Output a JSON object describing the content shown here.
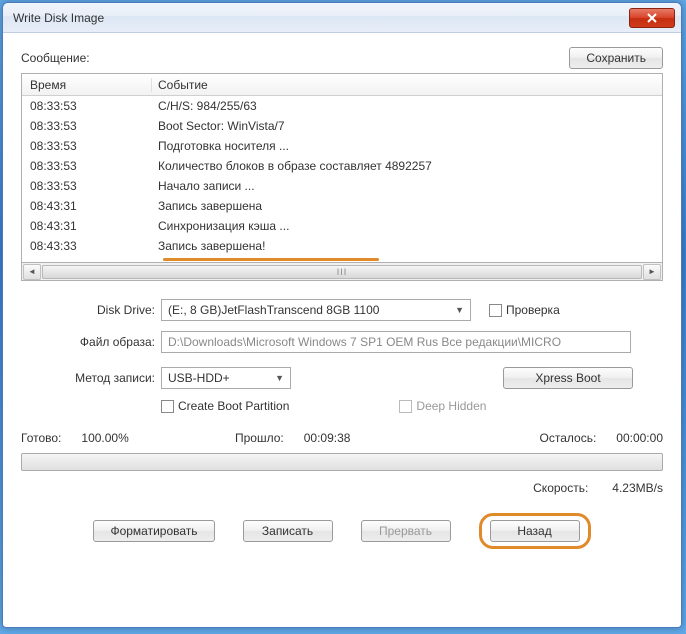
{
  "window": {
    "title": "Write Disk Image"
  },
  "msg": {
    "label": "Сообщение:",
    "save_btn": "Сохранить"
  },
  "log": {
    "col_time": "Время",
    "col_event": "Событие",
    "rows": [
      {
        "time": "08:33:53",
        "event": "C/H/S: 984/255/63"
      },
      {
        "time": "08:33:53",
        "event": "Boot Sector: WinVista/7"
      },
      {
        "time": "08:33:53",
        "event": "Подготовка носителя ..."
      },
      {
        "time": "08:33:53",
        "event": "Количество блоков в образе составляет 4892257"
      },
      {
        "time": "08:33:53",
        "event": "Начало записи ..."
      },
      {
        "time": "08:43:31",
        "event": "Запись завершена"
      },
      {
        "time": "08:43:31",
        "event": "Синхронизация кэша ..."
      },
      {
        "time": "08:43:33",
        "event": "Запись завершена!"
      }
    ]
  },
  "form": {
    "drive_label": "Disk Drive:",
    "drive_value": "(E:, 8 GB)JetFlashTranscend 8GB   1100",
    "verify_label": "Проверка",
    "image_label": "Файл образа:",
    "image_value": "D:\\Downloads\\Microsoft Windows 7 SP1 OEM Rus Все редакции\\MICRO",
    "method_label": "Метод записи:",
    "method_value": "USB-HDD+",
    "xpress_btn": "Xpress Boot",
    "create_boot_label": "Create Boot Partition",
    "deep_hidden_label": "Deep Hidden"
  },
  "status": {
    "ready_label": "Готово:",
    "ready_value": "100.00%",
    "elapsed_label": "Прошло:",
    "elapsed_value": "00:09:38",
    "remain_label": "Осталось:",
    "remain_value": "00:00:00",
    "speed_label": "Скорость:",
    "speed_value": "4.23MB/s"
  },
  "buttons": {
    "format": "Форматировать",
    "write": "Записать",
    "abort": "Прервать",
    "back": "Назад"
  }
}
